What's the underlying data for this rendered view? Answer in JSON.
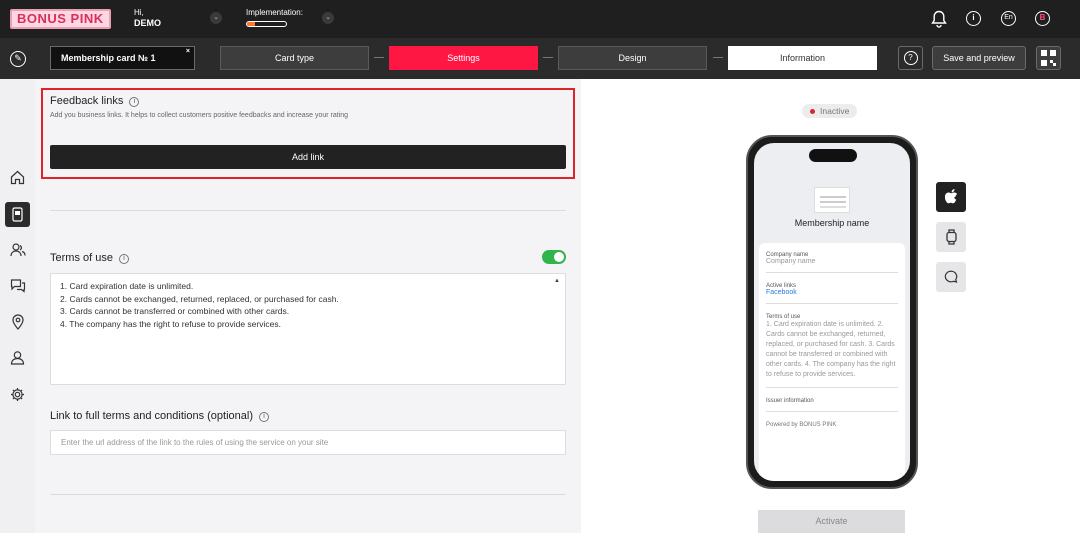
{
  "app": {
    "logo": "BONUS PINK"
  },
  "header": {
    "greeting": "Hi,",
    "user": "DEMO",
    "implementation_label": "Implementation:",
    "implementation_progress": 0.2,
    "language": "En",
    "avatar_letter": "B"
  },
  "toolbar": {
    "card_name": "Membership card № 1",
    "card_name_close": "×",
    "steps": [
      {
        "label": "Card type",
        "state": "default"
      },
      {
        "label": "Settings",
        "state": "active"
      },
      {
        "label": "Design",
        "state": "default"
      },
      {
        "label": "Information",
        "state": "highlight"
      }
    ],
    "help": "?",
    "save_label": "Save and preview"
  },
  "sidebar": {
    "items": [
      {
        "icon": "home-icon"
      },
      {
        "icon": "card-icon",
        "active": true
      },
      {
        "icon": "clients-icon"
      },
      {
        "icon": "chat-icon"
      },
      {
        "icon": "location-icon"
      },
      {
        "icon": "user-icon"
      },
      {
        "icon": "gear-icon"
      }
    ]
  },
  "feedback": {
    "title": "Feedback links",
    "description": "Add you business links. It helps to collect customers positive feedbacks and increase your rating",
    "add_label": "Add link"
  },
  "terms": {
    "title": "Terms of use",
    "enabled": true,
    "lines": [
      "1. Card expiration date is unlimited.",
      "2. Cards cannot be exchanged, returned, replaced, or purchased for cash.",
      "3. Cards cannot be transferred or combined with other cards.",
      "4. The company has the right to refuse to provide services."
    ]
  },
  "full_terms": {
    "title": "Link to full terms and conditions (optional)",
    "placeholder": "Enter the url address of the link to the rules of using the service on your site"
  },
  "preview": {
    "status": "Inactive",
    "membership_name": "Membership name",
    "company_label": "Company name",
    "company_value": "Company name",
    "links_label": "Active links",
    "links_value": "Facebook",
    "terms_label": "Terms of use",
    "terms_text": "1. Card expiration date is unlimited. 2. Cards cannot be exchanged, returned, replaced, or purchased for cash. 3. Cards cannot be transferred or combined with other cards. 4. The company has the right to refuse to provide services.",
    "issuer_label": "Issuer information",
    "powered": "Powered by BONUS PINK",
    "activate_label": "Activate"
  },
  "colors": {
    "accent": "#ff1744",
    "toggle": "#2fb54a",
    "highlight_border": "#e0222b"
  }
}
